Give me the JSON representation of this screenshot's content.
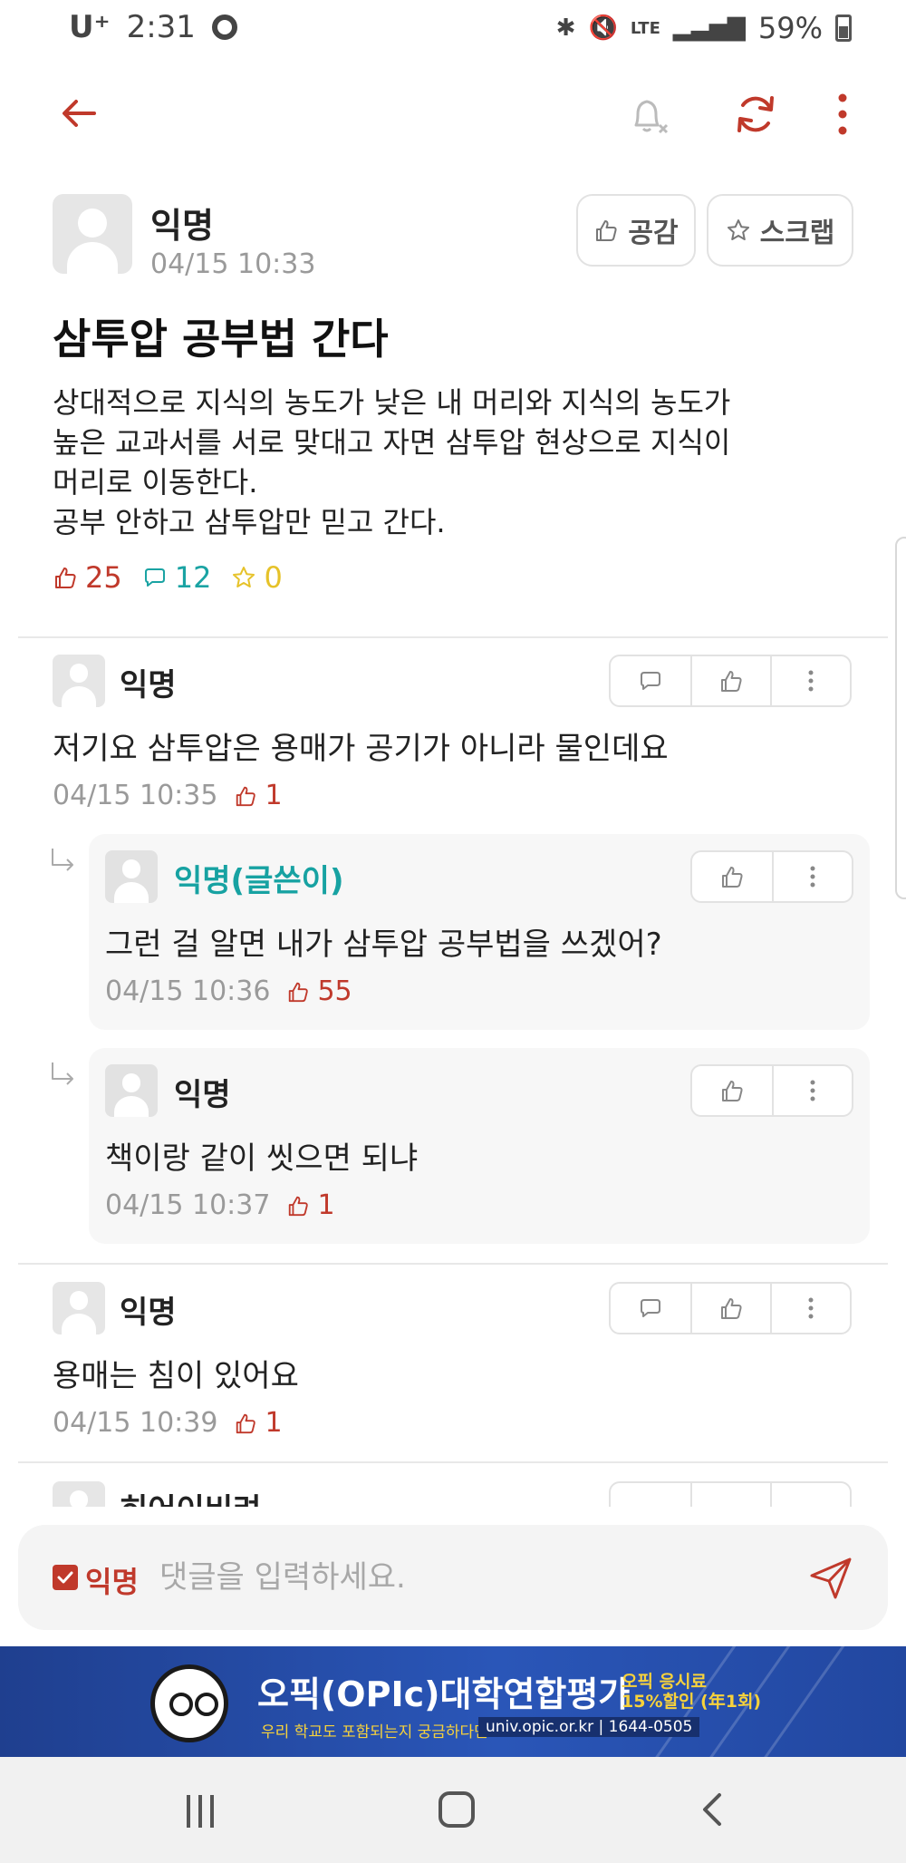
{
  "status_bar": {
    "carrier": "U⁺",
    "time": "2:31",
    "network": "LTE",
    "battery": "59%"
  },
  "post": {
    "author": "익명",
    "date": "04/15 10:33",
    "like_button": "공감",
    "scrap_button": "스크랩",
    "title": "삼투압 공부법 간다",
    "body": "상대적으로 지식의 농도가 낮은 내 머리와 지식의 농도가\n높은 교과서를 서로 맞대고 자면 삼투압 현상으로 지식이\n머리로 이동한다.\n공부 안하고 삼투압만 믿고 간다.",
    "like_count": "25",
    "comment_count": "12",
    "scrap_count": "0"
  },
  "comments": [
    {
      "author": "익명",
      "text": "저기요 삼투압은 용매가 공기가 아니라 물인데요",
      "date": "04/15 10:35",
      "likes": "1",
      "replies": [
        {
          "author": "익명(글쓴이)",
          "text": "그런 걸 알면 내가 삼투압 공부법을 쓰겠어?",
          "date": "04/15 10:36",
          "likes": "55"
        },
        {
          "author": "익명",
          "text": "책이랑 같이 씻으면 되냐",
          "date": "04/15 10:37",
          "likes": "1"
        }
      ]
    },
    {
      "author": "익명",
      "text": "용매는 침이 있어요",
      "date": "04/15 10:39",
      "likes": "1",
      "replies": []
    },
    {
      "author": "히어이비려",
      "text": "",
      "date": "",
      "likes": "",
      "replies": []
    }
  ],
  "input": {
    "anonymous_label": "익명",
    "placeholder": "댓글을 입력하세요."
  },
  "ad": {
    "title": "오픽(OPIc)대학연합평가",
    "badge_line1": "오픽 응시료",
    "badge_line2": "15%할인 (年1회)",
    "subtitle": "우리 학교도 포함되는지 궁금하다면?",
    "url": "univ.opic.or.kr | 1644-0505"
  },
  "colors": {
    "accent": "#c0392b",
    "teal": "#17a2a2",
    "star": "#e6c229",
    "ad_blue": "#2a56b8"
  },
  "icons": [
    "back-arrow-icon",
    "bell-off-icon",
    "refresh-icon",
    "more-vert-icon",
    "thumbs-up-icon",
    "star-icon",
    "comment-icon",
    "reply-arrow-icon",
    "send-icon",
    "check-icon"
  ]
}
